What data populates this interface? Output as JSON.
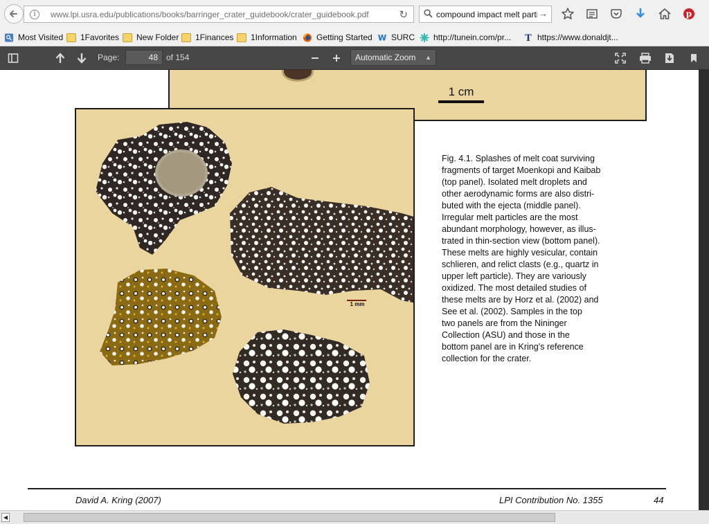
{
  "browser": {
    "url": "www.lpi.usra.edu/publications/books/barringer_crater_guidebook/crater_guidebook.pdf",
    "search_value": "compound impact melt partic"
  },
  "bookmarks": [
    {
      "label": "Most Visited",
      "icon": "bookmark-star-icon"
    },
    {
      "label": "1Favorites",
      "icon": "folder-icon"
    },
    {
      "label": "New Folder",
      "icon": "folder-icon"
    },
    {
      "label": "1Finances",
      "icon": "folder-icon"
    },
    {
      "label": "1Information",
      "icon": "folder-icon"
    },
    {
      "label": "Getting Started",
      "icon": "firefox-icon"
    },
    {
      "label": "SURC",
      "icon": "surc-icon"
    },
    {
      "label": "http://tunein.com/pr...",
      "icon": "tunein-icon"
    },
    {
      "label": "https://www.donaldjt...",
      "icon": "t-icon"
    }
  ],
  "pdf_toolbar": {
    "page_label": "Page:",
    "page_value": "48",
    "page_total": "of 154",
    "zoom": "Automatic Zoom"
  },
  "document": {
    "top_scale_label": "1 cm",
    "panel_scale_label": "1 mm",
    "caption": "Fig. 4.1.  Splashes of melt coat surviving\nfragments of target Moenkopi and Kaibab\n(top panel).  Isolated melt droplets and\nother aerodynamic forms are also distri-\nbuted with the ejecta (middle panel).\nIrregular melt particles are the most\nabundant morphology, however, as illus-\ntrated in thin-section view (bottom panel).\nThese melts are highly vesicular, contain\nschlieren, and relict clasts (e.g., quartz in\nupper left particle).  They are variously\noxidized.  The most detailed studies of\nthese melts are by Horz et al. (2002) and\nSee et al. (2002).  Samples in the top\ntwo panels are from the Nininger\nCollection (ASU) and those in the\nbottom panel are in Kring’s reference\ncollection for the crater.",
    "footer_author": "David A. Kring (2007)",
    "footer_contribution": "LPI Contribution No. 1355",
    "footer_page": "44"
  },
  "colors": {
    "panel_bg": "#ebd59f",
    "pdf_toolbar": "#474747",
    "browser_chrome": "#f0f0f0"
  }
}
